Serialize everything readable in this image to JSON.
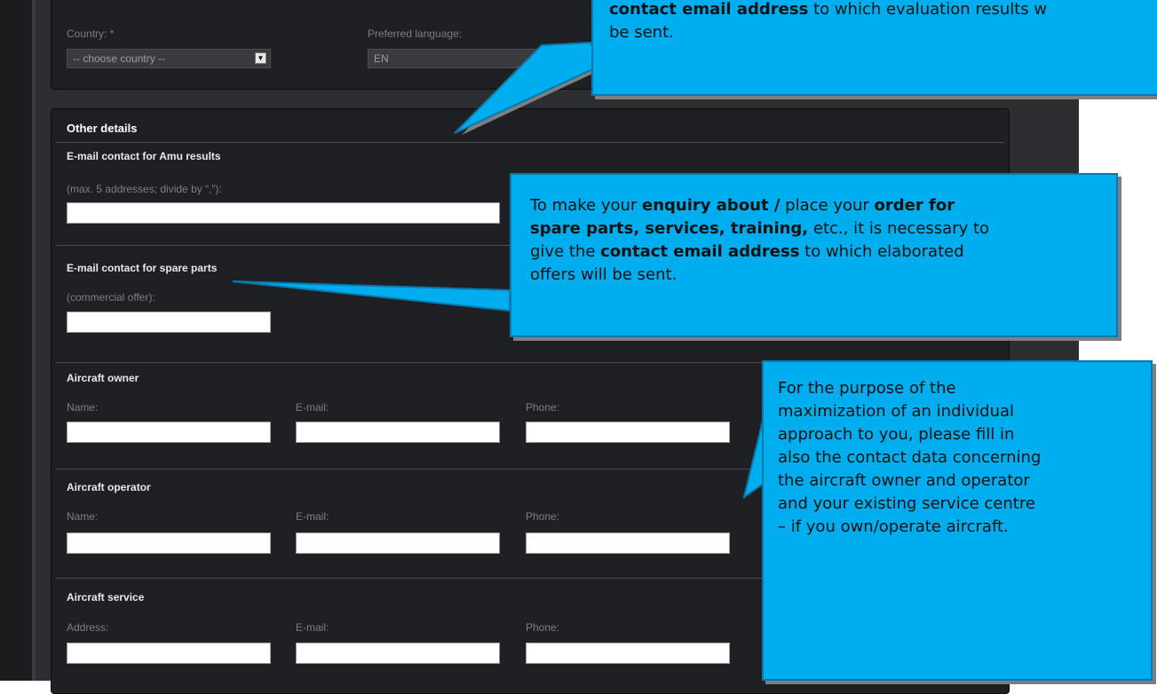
{
  "top_panel": {
    "country_label": "Country: *",
    "country_select": "-- choose country --",
    "language_label": "Preferred language:",
    "language_value": "EN"
  },
  "other_details": {
    "title": "Other details",
    "amu": {
      "heading": "E-mail contact for Amu results",
      "hint": "(max. 5 addresses; divide by “,”):"
    },
    "spare": {
      "heading": "E-mail contact for spare parts",
      "hint": "(commercial offer):"
    },
    "owner": {
      "heading": "Aircraft owner",
      "col1": "Name:",
      "col2": "E-mail:",
      "col3": "Phone:"
    },
    "operator": {
      "heading": "Aircraft operator",
      "col1": "Name:",
      "col2": "E-mail:",
      "col3": "Phone:"
    },
    "service": {
      "heading": "Aircraft service",
      "col1": "Address:",
      "col2": "E-mail:",
      "col3": "Phone:"
    }
  },
  "callouts": {
    "top": {
      "line1_bold": "contact email address",
      "line1_rest": " to which evaluation results w",
      "line2": "be sent."
    },
    "middle": {
      "t1": "To make your ",
      "b1": "enquiry about /",
      "t2": " place your ",
      "b2": "order for",
      "b3": "spare parts, services, training,",
      "t3": " etc., it is necessary to",
      "t4": "give the ",
      "b4": "contact email address",
      "t5": " to which elaborated",
      "t6": "offers will be sent."
    },
    "bottom": {
      "lines": [
        "For the purpose of the",
        "maximization of an individual",
        "approach to you, please fill in",
        "also the contact data concerning",
        "the aircraft owner and operator",
        "and your existing service centre",
        "– if you own/operate aircraft."
      ]
    }
  }
}
